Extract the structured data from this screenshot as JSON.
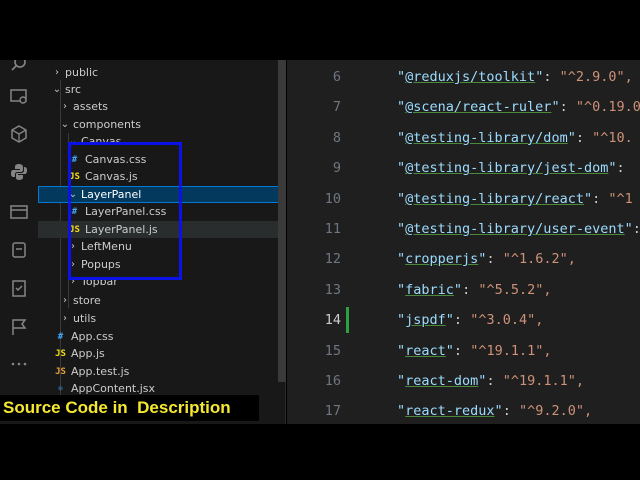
{
  "explorer": {
    "items": [
      {
        "name": "tree-item-public",
        "label": "public",
        "chev": "›",
        "kind": "folder"
      },
      {
        "name": "tree-item-src",
        "label": "src",
        "chev": "⌄",
        "kind": "folder"
      },
      {
        "name": "tree-item-assets",
        "label": "assets",
        "chev": "›",
        "kind": "folder"
      },
      {
        "name": "tree-item-components",
        "label": "components",
        "chev": "⌄",
        "kind": "folder"
      },
      {
        "name": "tree-item-canvas-folder",
        "label": "Canvas",
        "chev": "⌄",
        "kind": "folder"
      },
      {
        "name": "tree-item-canvas-css",
        "label": "Canvas.css",
        "icon": "#",
        "kind": "css"
      },
      {
        "name": "tree-item-canvas-js",
        "label": "Canvas.js",
        "icon": "JS",
        "kind": "js"
      },
      {
        "name": "tree-item-layerpanel-folder",
        "label": "LayerPanel",
        "chev": "⌄",
        "kind": "folder"
      },
      {
        "name": "tree-item-layerpanel-css",
        "label": "LayerPanel.css",
        "icon": "#",
        "kind": "css"
      },
      {
        "name": "tree-item-layerpanel-js",
        "label": "LayerPanel.js",
        "icon": "JS",
        "kind": "js"
      },
      {
        "name": "tree-item-leftmenu",
        "label": "LeftMenu",
        "chev": "›",
        "kind": "folder"
      },
      {
        "name": "tree-item-popups",
        "label": "Popups",
        "chev": "›",
        "kind": "folder"
      },
      {
        "name": "tree-item-topbar",
        "label": "Topbar",
        "chev": "›",
        "kind": "folder"
      },
      {
        "name": "tree-item-store",
        "label": "store",
        "chev": "›",
        "kind": "folder"
      },
      {
        "name": "tree-item-utils",
        "label": "utils",
        "chev": "›",
        "kind": "folder"
      },
      {
        "name": "tree-item-app-css",
        "label": "App.css",
        "icon": "#",
        "kind": "css"
      },
      {
        "name": "tree-item-app-js",
        "label": "App.js",
        "icon": "JS",
        "kind": "js"
      },
      {
        "name": "tree-item-app-test-js",
        "label": "App.test.js",
        "icon": "JS",
        "kind": "jsr"
      },
      {
        "name": "tree-item-appcontent-jsx",
        "label": "AppContent.jsx",
        "icon": "⚛",
        "kind": "css"
      }
    ]
  },
  "editor": {
    "lines": [
      {
        "n": "6",
        "key": "@reduxjs/toolkit",
        "value": "\"^2.9.0\","
      },
      {
        "n": "7",
        "key": "@scena/react-ruler",
        "value": "\"^0.19.0"
      },
      {
        "n": "8",
        "key": "@testing-library/dom",
        "value": "\"^10."
      },
      {
        "n": "9",
        "key": "@testing-library/jest-dom",
        "value": ""
      },
      {
        "n": "10",
        "key": "@testing-library/react",
        "value": "\"^1"
      },
      {
        "n": "11",
        "key": "@testing-library/user-event",
        "value": ""
      },
      {
        "n": "12",
        "key": "cropperjs",
        "value": "\"^1.6.2\","
      },
      {
        "n": "13",
        "key": "fabric",
        "value": "\"^5.5.2\","
      },
      {
        "n": "14",
        "key": "jspdf",
        "value": "\"^3.0.4\","
      },
      {
        "n": "15",
        "key": "react",
        "value": "\"^19.1.1\","
      },
      {
        "n": "16",
        "key": "react-dom",
        "value": "\"^19.1.1\","
      },
      {
        "n": "17",
        "key": "react-redux",
        "value": "\"^9.2.0\","
      }
    ]
  },
  "banner": {
    "text": "Source Code in  Description"
  },
  "colors": {
    "accent": "#0078d4",
    "annotation": "#0a12e8",
    "banner_text": "#f5e830"
  }
}
